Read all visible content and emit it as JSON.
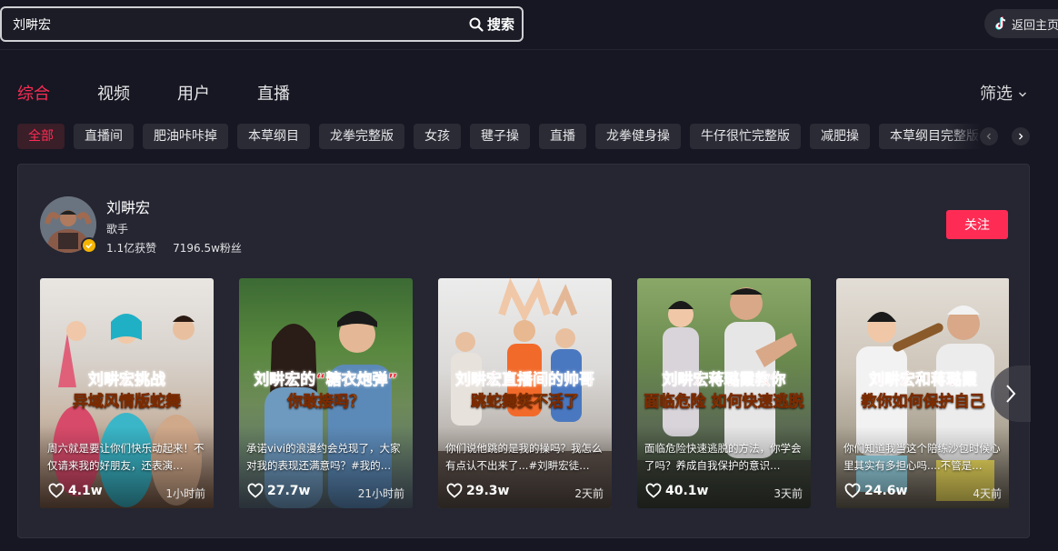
{
  "search": {
    "value": "刘畊宏",
    "button_label": "搜索"
  },
  "header": {
    "return_label": "返回主页"
  },
  "tabs": [
    {
      "label": "综合",
      "active": true
    },
    {
      "label": "视频",
      "active": false
    },
    {
      "label": "用户",
      "active": false
    },
    {
      "label": "直播",
      "active": false
    }
  ],
  "filter_label": "筛选",
  "chips": [
    "全部",
    "直播间",
    "肥油咔咔掉",
    "本草纲目",
    "龙拳完整版",
    "女孩",
    "毽子操",
    "直播",
    "龙拳健身操",
    "牛仔很忙完整版",
    "减肥操",
    "本草纲目完整版"
  ],
  "user": {
    "name": "刘畊宏",
    "role": "歌手",
    "likes": "1.1亿获赞",
    "fans": "7196.5w粉丝",
    "follow_label": "关注"
  },
  "videos": [
    {
      "cap1": "刘畊宏挑战",
      "cap2": "异域风情版蛇舞",
      "desc": "周六就是要让你们快乐动起来！不仅请来我的好朋友，还表演…",
      "likes": "4.1w",
      "time": "1小时前"
    },
    {
      "cap1": "刘畊宏的“糖衣炮弹”",
      "cap2": "你敢接吗？",
      "desc": "承诺vivi的浪漫约会兑现了，大家对我的表现还满意吗？#我的…",
      "likes": "27.7w",
      "time": "21小时前"
    },
    {
      "cap1": "刘畊宏直播间的帅哥",
      "cap2": "跳蛇舞笑不活了",
      "desc": "你们说他跳的是我的操吗？我怎么有点认不出来了...#刘畊宏徒…",
      "likes": "29.3w",
      "time": "2天前"
    },
    {
      "cap1": "刘畊宏蒋璐霞教你",
      "cap2": "面临危险 如何快速逃脱",
      "desc": "面临危险快速逃脱的方法，你学会了吗？养成自我保护的意识…",
      "likes": "40.1w",
      "time": "3天前"
    },
    {
      "cap1": "刘畊宏和蒋璐霞",
      "cap2": "教你如何保护自己",
      "desc": "你们知道我当这个陪练沙包时候心里其实有多担心吗....不管是…",
      "likes": "24.6w",
      "time": "4天前"
    }
  ],
  "colors": {
    "accent": "#fe2c55",
    "background": "#161722",
    "card": "#252632",
    "verified": "#f5b400"
  }
}
